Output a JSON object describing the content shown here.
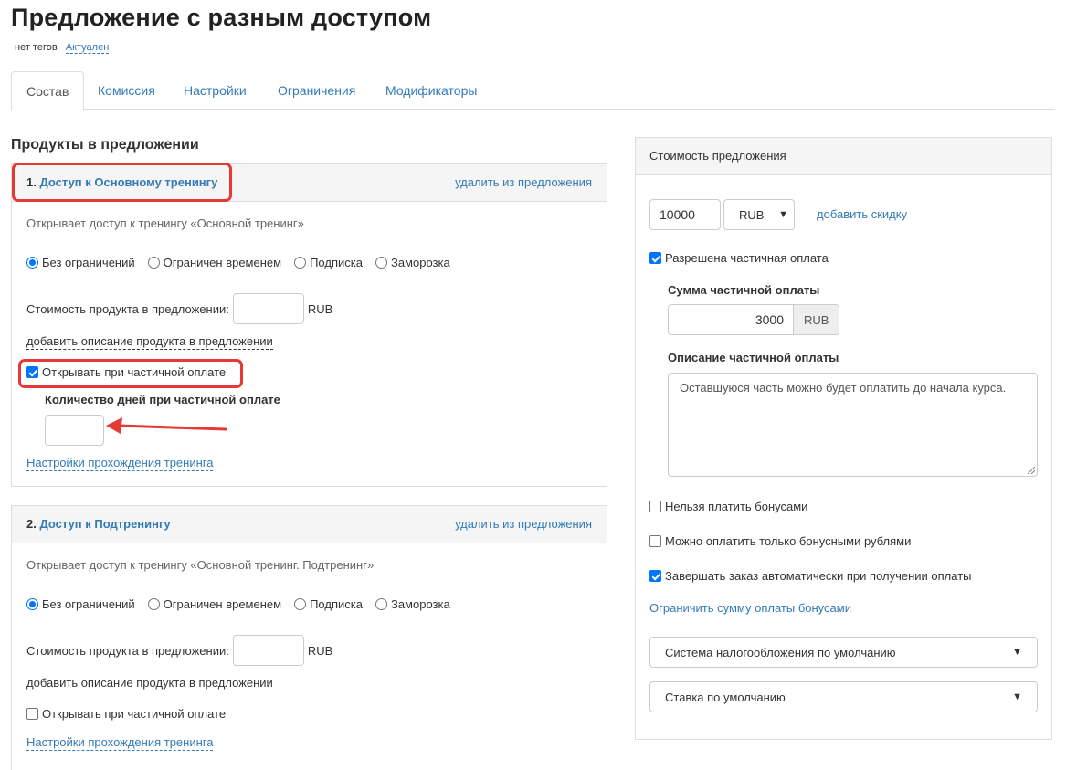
{
  "page": {
    "title": "Предложение с разным доступом",
    "tags_text": "нет тегов",
    "status": "Актуален"
  },
  "tabs": [
    {
      "label": "Состав",
      "active": true
    },
    {
      "label": "Комиссия",
      "active": false
    },
    {
      "label": "Настройки",
      "active": false
    },
    {
      "label": "Ограничения",
      "active": false
    },
    {
      "label": "Модификаторы",
      "active": false
    }
  ],
  "products_section": {
    "title": "Продукты в предложении",
    "products": [
      {
        "number": "1.",
        "name": "Доступ к Основному тренингу",
        "remove_label": "удалить из предложения",
        "description": "Открывает доступ к тренингу «Основной тренинг»",
        "access_options": [
          "Без ограничений",
          "Ограничен временем",
          "Подписка",
          "Заморозка"
        ],
        "selected_option": "Без ограничений",
        "cost_label": "Стоимость продукта в предложении:",
        "cost_value": "",
        "currency": "RUB",
        "add_description_label": "добавить описание продукта в предложении",
        "partial_open_label": "Открывать при частичной оплате",
        "partial_open_checked": true,
        "days_label": "Количество дней при частичной оплате",
        "days_value": "",
        "training_settings_label": "Настройки прохождения тренинга"
      },
      {
        "number": "2.",
        "name": "Доступ к Подтренингу",
        "remove_label": "удалить из предложения",
        "description": "Открывает доступ к тренингу «Основной тренинг. Подтренинг»",
        "access_options": [
          "Без ограничений",
          "Ограничен временем",
          "Подписка",
          "Заморозка"
        ],
        "selected_option": "Без ограничений",
        "cost_label": "Стоимость продукта в предложении:",
        "cost_value": "",
        "currency": "RUB",
        "add_description_label": "добавить описание продукта в предложении",
        "partial_open_label": "Открывать при частичной оплате",
        "partial_open_checked": false,
        "training_settings_label": "Настройки прохождения тренинга"
      }
    ]
  },
  "price_panel": {
    "title": "Стоимость предложения",
    "price_value": "10000",
    "currency": "RUB",
    "add_discount_label": "добавить скидку",
    "partial_allowed_label": "Разрешена частичная оплата",
    "partial_allowed_checked": true,
    "partial_sum_label": "Сумма частичной оплаты",
    "partial_sum_value": "3000",
    "partial_sum_currency": "RUB",
    "partial_desc_label": "Описание частичной оплаты",
    "partial_desc_value": "Оставшуюся часть можно будет оплатить до начала курса.",
    "no_bonus_label": "Нельзя платить бонусами",
    "no_bonus_checked": false,
    "only_bonus_label": "Можно оплатить только бонусными рублями",
    "only_bonus_checked": false,
    "auto_complete_label": "Завершать заказ автоматически при получении оплаты",
    "auto_complete_checked": true,
    "limit_bonus_label": "Ограничить сумму оплаты бонусами",
    "tax_system": "Система налогообложения по умолчанию",
    "tax_rate": "Ставка по умолчанию"
  },
  "colors": {
    "link": "#337ab7",
    "highlight": "#e53935",
    "checkbox": "#0075ff"
  }
}
